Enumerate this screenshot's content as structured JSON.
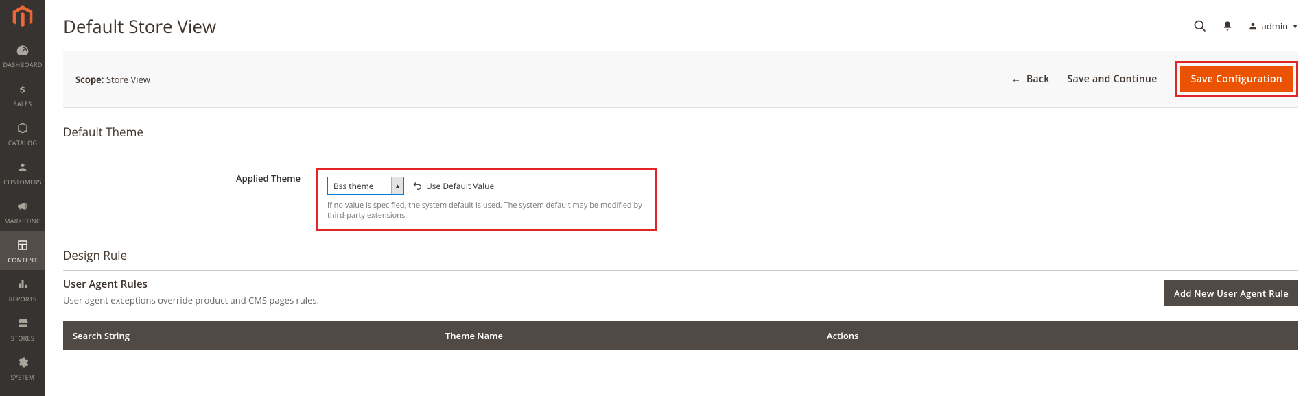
{
  "sidebar": {
    "items": [
      {
        "label": "DASHBOARD"
      },
      {
        "label": "SALES"
      },
      {
        "label": "CATALOG"
      },
      {
        "label": "CUSTOMERS"
      },
      {
        "label": "MARKETING"
      },
      {
        "label": "CONTENT"
      },
      {
        "label": "REPORTS"
      },
      {
        "label": "STORES"
      },
      {
        "label": "SYSTEM"
      }
    ]
  },
  "header": {
    "title": "Default Store View",
    "admin_label": "admin"
  },
  "toolbar": {
    "scope_label": "Scope:",
    "scope_value": "Store View",
    "back_label": "Back",
    "save_continue_label": "Save and Continue",
    "save_config_label": "Save Configuration"
  },
  "default_theme": {
    "section_title": "Default Theme",
    "field_label": "Applied Theme",
    "select_value": "Bss theme",
    "use_default_label": "Use Default Value",
    "hint": "If no value is specified, the system default is used. The system default may be modified by third-party extensions."
  },
  "design_rule": {
    "section_title": "Design Rule"
  },
  "user_agent": {
    "title": "User Agent Rules",
    "subtitle": "User agent exceptions override product and CMS pages rules.",
    "add_btn": "Add New User Agent Rule",
    "cols": {
      "c1": "Search String",
      "c2": "Theme Name",
      "c3": "Actions"
    }
  }
}
